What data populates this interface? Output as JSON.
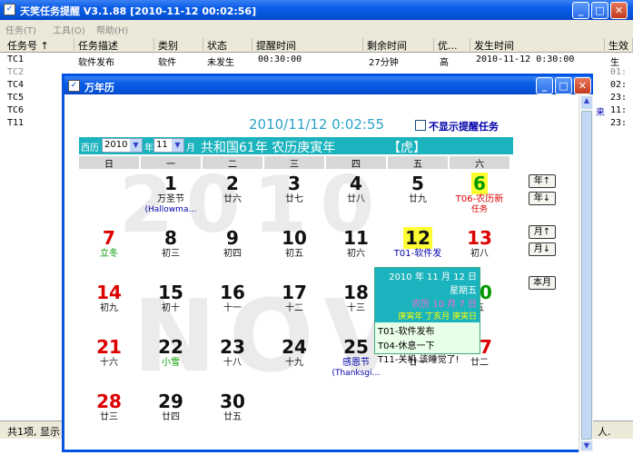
{
  "main": {
    "title": "天笑任务提醒 V3.1.88 [2010-11-12 00:02:56]",
    "menu": [
      "任务(T)",
      "工具(O)",
      "帮助(H)"
    ],
    "headers": [
      "任务号 ↑",
      "任务描述",
      "类别",
      "状态",
      "提醒时间",
      "剩余时间",
      "优...",
      "发生时间",
      "生效"
    ],
    "rows": [
      {
        "id": "TC1",
        "desc": "软件发布",
        "cat": "软件",
        "state": "未发生",
        "remind": "00:30:00",
        "left": "27分钟",
        "pri": "高",
        "time": "2010-11-12 0:30:00",
        "eff": "生"
      },
      {
        "id": "TC2",
        "eff": "01:"
      },
      {
        "id": "TC4",
        "eff": "02:"
      },
      {
        "id": "TC5",
        "eff": "23:"
      },
      {
        "id": "TC6",
        "eff": "11:"
      },
      {
        "id": "T11",
        "eff": "23:"
      }
    ],
    "right_frag": [
      "来",
      "生",
      "上"
    ],
    "status_left": "共1项, 显示",
    "status_right": "人."
  },
  "calendar": {
    "title": "万年历",
    "datetime": "2010/11/12 0:02:55",
    "hide_reminder": "不显示提醒任务",
    "year_prefix": "西历",
    "year": "2010",
    "year_label": "年",
    "month": "11",
    "month_label": "月",
    "lunar_info": "共和国61年  农历庚寅年",
    "zodiac": "【虎】",
    "weekdays": [
      "日",
      "一",
      "二",
      "三",
      "四",
      "五",
      "六"
    ],
    "watermark_year": "2010",
    "watermark_month": "NOV",
    "buttons": [
      "年↑",
      "年↓",
      "月↑",
      "月↓",
      "本月"
    ],
    "days": [
      {
        "n": "1",
        "lu": "万圣节",
        "ev": "(Hallowma…",
        "evc": "#00a"
      },
      {
        "n": "2",
        "lu": "廿六"
      },
      {
        "n": "3",
        "lu": "廿七"
      },
      {
        "n": "4",
        "lu": "廿八"
      },
      {
        "n": "5",
        "lu": "廿九"
      },
      {
        "n": "6",
        "lu": "T06-农历新",
        "ev": "任务",
        "luc": "#d00",
        "evc": "#d00",
        "hl": true,
        "nc": "#090"
      },
      {
        "n": "7",
        "lu": "立冬",
        "nc": "#d00",
        "luc": "#090"
      },
      {
        "n": "8",
        "lu": "初三"
      },
      {
        "n": "9",
        "lu": "初四"
      },
      {
        "n": "10",
        "lu": "初五"
      },
      {
        "n": "11",
        "lu": "初六"
      },
      {
        "n": "12",
        "lu": "T01-软件发",
        "luc": "#00a",
        "hl": true
      },
      {
        "n": "13",
        "lu": "初八",
        "nc": "#d00"
      },
      {
        "n": "14",
        "lu": "初九",
        "nc": "#d00"
      },
      {
        "n": "15",
        "lu": "初十"
      },
      {
        "n": "16",
        "lu": "十一"
      },
      {
        "n": "17",
        "lu": "十二"
      },
      {
        "n": "18",
        "lu": "十三"
      },
      {
        "n": "19",
        "lu": ""
      },
      {
        "n": "20",
        "lu": "五",
        "nc": "#090"
      },
      {
        "n": "21",
        "lu": "十六",
        "nc": "#d00"
      },
      {
        "n": "22",
        "lu": "小雪",
        "luc": "#090"
      },
      {
        "n": "23",
        "lu": "十八"
      },
      {
        "n": "24",
        "lu": "十九"
      },
      {
        "n": "25",
        "lu": "感恩节",
        "ev": "(Thanksgi…",
        "luc": "#00a",
        "evc": "#00a"
      },
      {
        "n": "26",
        "lu": "廿一"
      },
      {
        "n": "27",
        "lu": "廿二",
        "nc": "#d00"
      },
      {
        "n": "28",
        "lu": "廿三",
        "nc": "#d00"
      },
      {
        "n": "29",
        "lu": "廿四"
      },
      {
        "n": "30",
        "lu": "廿五"
      }
    ],
    "popup": {
      "date": "2010 年 11 月 12 日",
      "weekday": "星期五",
      "lunar": "农历 10 月 7 日",
      "ganzhi": "庚寅年  丁亥月  庚寅日",
      "tasks": [
        "T01-软件发布",
        "T04-休息一下",
        "T11-关机 该睡觉了!"
      ]
    }
  }
}
